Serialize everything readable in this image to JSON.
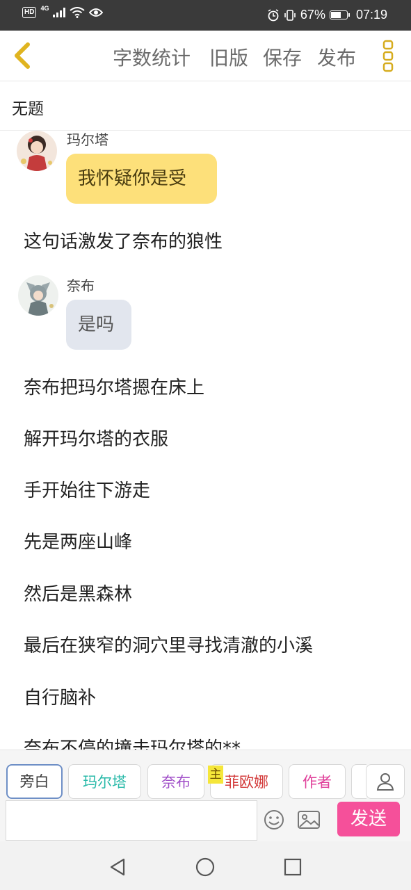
{
  "status_bar": {
    "hd": "HD",
    "network": "4G",
    "battery": "67%",
    "battery_level": 0.67,
    "time": "07:19"
  },
  "header": {
    "word_count": "字数统计",
    "old_version": "旧版",
    "save": "保存",
    "publish": "发布"
  },
  "title": "无题",
  "messages": [
    {
      "speaker": "玛尔塔",
      "text": "我怀疑你是受",
      "bubble_color": "#fde07a",
      "avatar": "marta-avatar"
    },
    {
      "narration": "这句话激发了奈布的狼性"
    },
    {
      "speaker": "奈布",
      "text": "是吗",
      "bubble_color": "#e2e6ee",
      "avatar": "naib-avatar"
    },
    {
      "narration": "奈布把玛尔塔摁在床上"
    },
    {
      "narration": "解开玛尔塔的衣服"
    },
    {
      "narration": "手开始往下游走"
    },
    {
      "narration": "先是两座山峰"
    },
    {
      "narration": "然后是黑森林"
    },
    {
      "narration": "最后在狭窄的洞穴里寻找清澈的小溪"
    },
    {
      "narration": "自行脑补"
    },
    {
      "narration": "奈布不停的撞击玛尔塔的**"
    }
  ],
  "roles": [
    {
      "label": "旁白",
      "color": "#3a3a3a",
      "active": true
    },
    {
      "label": "玛尔塔",
      "color": "#27b9a8"
    },
    {
      "label": "奈布",
      "color": "#a04ec8"
    },
    {
      "label": "菲欧娜",
      "color": "#d33a3a",
      "badge": "主"
    },
    {
      "label": "作者",
      "color": "#e0409a"
    }
  ],
  "input": {
    "placeholder": "",
    "send_label": "发送"
  },
  "colors": {
    "accent": "#f5509a",
    "back_arrow": "#e0b420"
  }
}
